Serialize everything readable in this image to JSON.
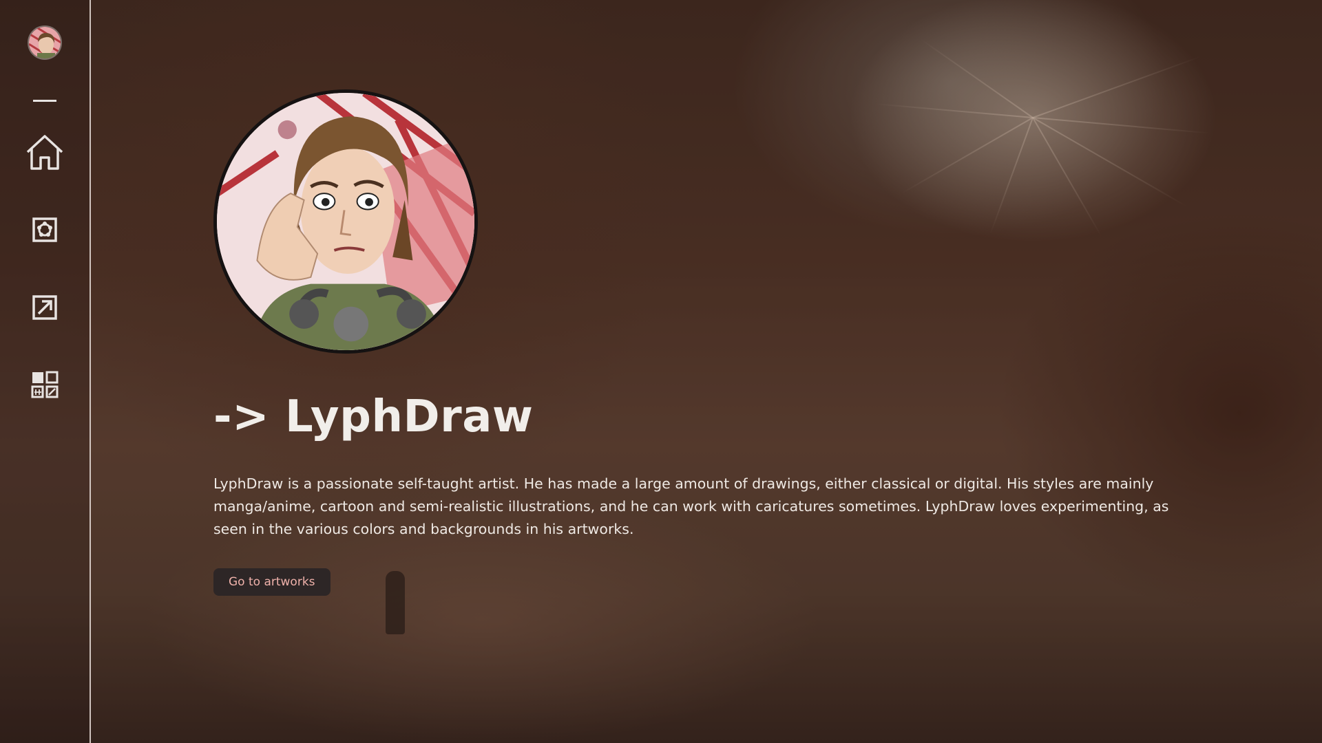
{
  "sidebar": {
    "items": [
      {
        "name": "home",
        "icon": "home-icon"
      },
      {
        "name": "about",
        "icon": "flower-badge-icon"
      },
      {
        "name": "external-link",
        "icon": "arrow-out-icon"
      },
      {
        "name": "gallery",
        "icon": "grid-apps-icon"
      }
    ]
  },
  "profile": {
    "title": "-> LyphDraw",
    "description": "LyphDraw is a passionate self-taught artist. He has made a large amount of drawings, either classical or digital. His styles are mainly manga/anime, cartoon and semi-realistic illustrations, and he can work with caricatures sometimes. LyphDraw loves experimenting, as seen in the various colors and backgrounds in his artworks.",
    "cta_label": "Go to artworks"
  },
  "colors": {
    "accent_text": "#f0b2ab",
    "button_bg": "#2d2626",
    "title_text": "#f1eeea",
    "sidebar_line": "#e8e4e2"
  }
}
